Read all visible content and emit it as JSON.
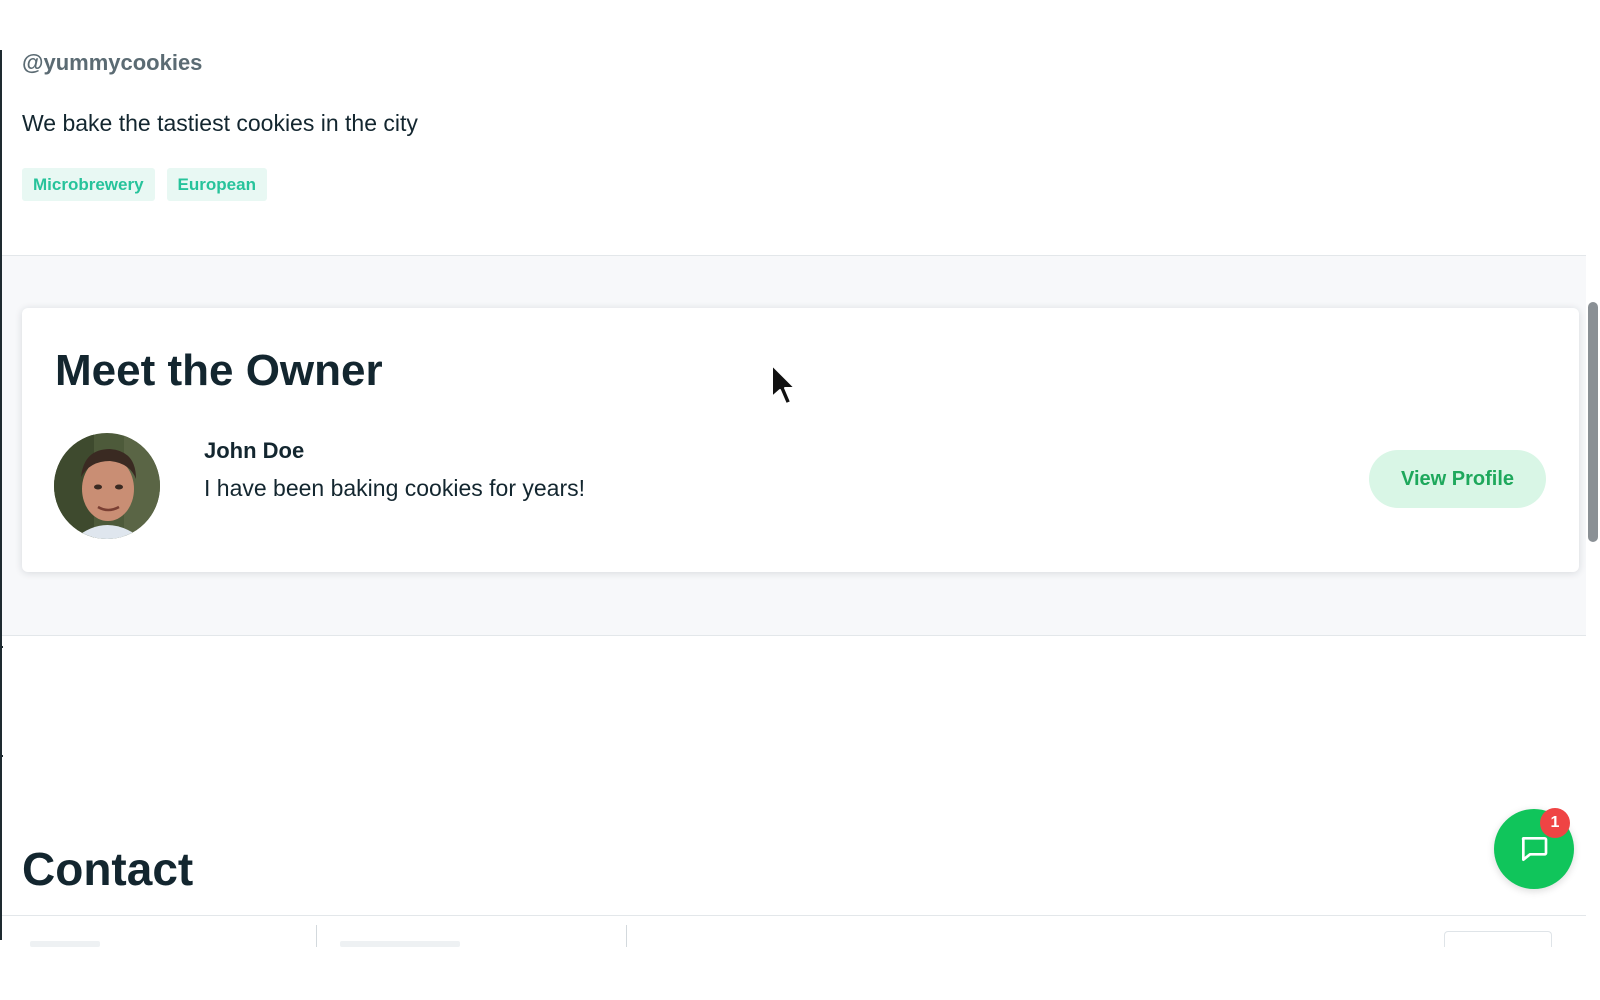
{
  "profile": {
    "handle": "@yummycookies",
    "tagline": "We bake the tastiest cookies in the city",
    "tags": [
      "Microbrewery",
      "European"
    ]
  },
  "owner": {
    "section_title": "Meet the Owner",
    "name": "John Doe",
    "bio": "I have been baking cookies for years!",
    "view_profile_label": "View Profile"
  },
  "contact": {
    "section_title": "Contact"
  },
  "chat": {
    "icon": "chat-bubble-icon",
    "unread_count": "1"
  },
  "colors": {
    "brand_green": "#10c55b",
    "tag_text": "#27c39b",
    "tag_bg": "#e8f8f3",
    "badge_red": "#ef4444",
    "heading": "#13262f"
  }
}
